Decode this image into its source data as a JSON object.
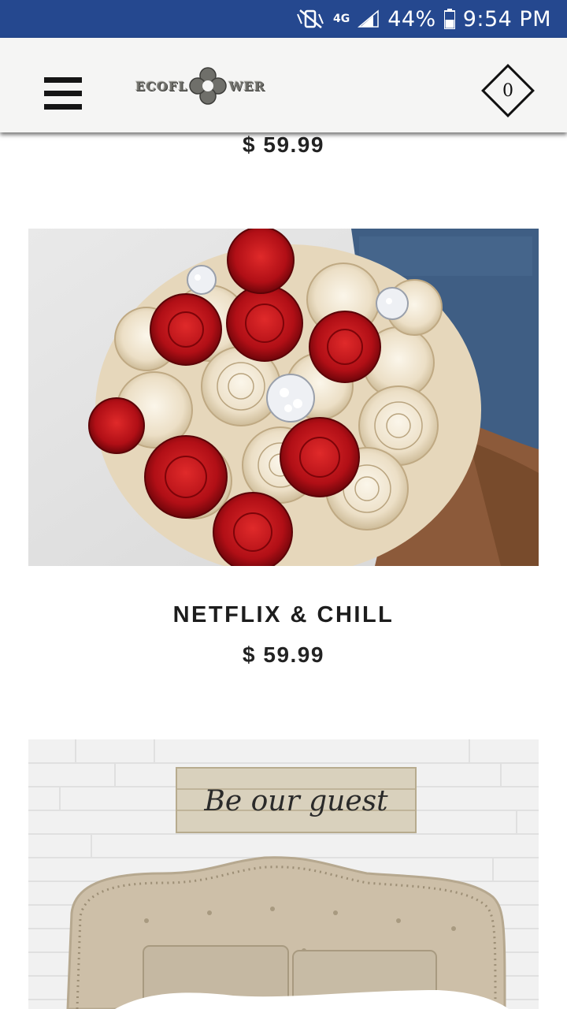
{
  "status_bar": {
    "network": "4G",
    "battery": "44%",
    "time": "9:54 PM",
    "icons": [
      "mute-vibrate-icon",
      "network-4g-icon",
      "signal-icon",
      "battery-icon"
    ],
    "bg_color": "#25488f"
  },
  "header": {
    "logo_text_before": "ECOFL",
    "logo_text_after": "WER",
    "cart_count": "0",
    "icons": [
      "hamburger-menu-icon",
      "cart-diamond-icon"
    ]
  },
  "products": [
    {
      "price": "$ 59.99"
    },
    {
      "name": "NETFLIX & CHILL",
      "price": "$ 59.99",
      "image": "red-and-ivory-wood-flower-bouquet"
    },
    {
      "image": "be-our-guest-sign-bedroom"
    }
  ],
  "sign_text": "Be our guest"
}
